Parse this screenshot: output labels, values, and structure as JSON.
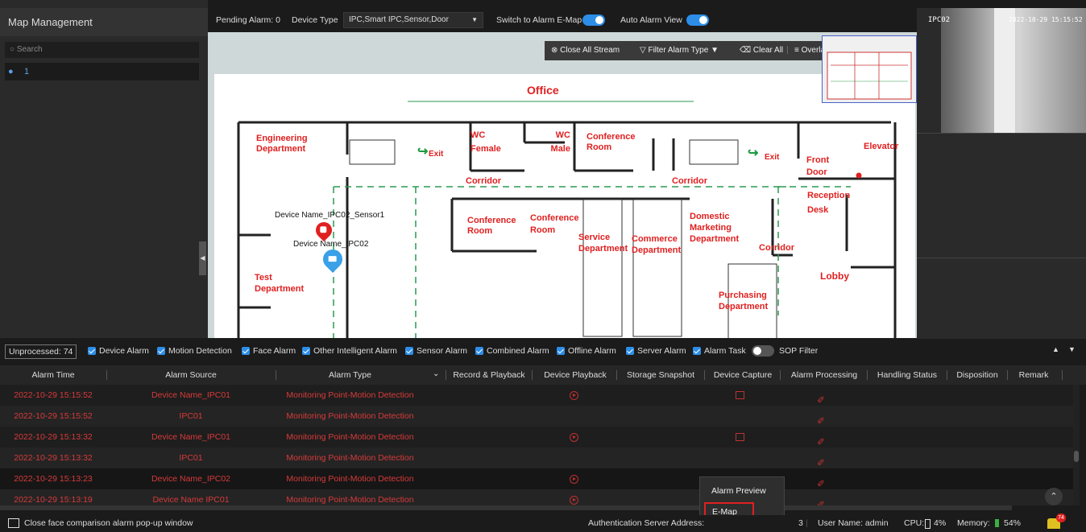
{
  "left_panel": {
    "title": "Map Management",
    "search_placeholder": "Search",
    "tree_node": "1"
  },
  "toolbar": {
    "pending_alarm": "Pending Alarm: 0",
    "device_type_label": "Device Type",
    "device_type_value": "IPC,Smart IPC,Sensor,Door",
    "switch_emap_label": "Switch to Alarm E-Map",
    "switch_emap_on": true,
    "auto_alarm_label": "Auto Alarm View",
    "auto_alarm_on": true
  },
  "map_tools": {
    "close_all_stream": "Close All Stream",
    "filter_alarm_type": "Filter Alarm Type",
    "clear_all": "Clear All",
    "overlap": "Overlap"
  },
  "floorplan": {
    "title": "Office",
    "rooms": [
      "Engineering Department",
      "Exit",
      "WC Female",
      "WC Male",
      "Conference Room",
      "Exit",
      "Front Door",
      "Elevator",
      "Corridor",
      "Corridor",
      "Reception Desk",
      "Conference Room",
      "Conference Room",
      "Service Department",
      "Commerce Department",
      "Domestic Marketing Department",
      "Corridor",
      "Lobby",
      "Test Department",
      "Purchasing Department"
    ],
    "marker_sensor": "Device Name_IPC02_Sensor1",
    "marker_ipc": "Device Name_IPC02"
  },
  "video": {
    "channel_label": "IPC02",
    "timestamp": "2022-10-29 15:15:52"
  },
  "filters": {
    "unprocessed": "Unprocessed: 74",
    "items": [
      "Device Alarm",
      "Motion Detection",
      "Face Alarm",
      "Other Intelligent Alarm",
      "Sensor Alarm",
      "Combined Alarm",
      "Offline Alarm",
      "Server Alarm",
      "Alarm Task"
    ],
    "sop_filter": "SOP Filter"
  },
  "table": {
    "headers": [
      "Alarm Time",
      "Alarm Source",
      "Alarm Type",
      "Record & Playback",
      "Device Playback",
      "Storage Snapshot",
      "Device Capture",
      "Alarm Processing",
      "Handling Status",
      "Disposition",
      "Remark"
    ],
    "rows": [
      {
        "time": "2022-10-29 15:15:52",
        "source": "Device Name_IPC01",
        "type": "Monitoring Point-Motion Detection",
        "playback": true,
        "capture": true
      },
      {
        "time": "2022-10-29 15:15:52",
        "source": "IPC01",
        "type": "Monitoring Point-Motion Detection",
        "playback": false,
        "capture": false
      },
      {
        "time": "2022-10-29 15:13:32",
        "source": "Device Name_IPC01",
        "type": "Monitoring Point-Motion Detection",
        "playback": true,
        "capture": true
      },
      {
        "time": "2022-10-29 15:13:32",
        "source": "IPC01",
        "type": "Monitoring Point-Motion Detection",
        "playback": false,
        "capture": false
      },
      {
        "time": "2022-10-29 15:13:23",
        "source": "Device Name_IPC02",
        "type": "Monitoring Point-Motion Detection",
        "playback": true,
        "capture": false
      },
      {
        "time": "2022-10-29 15:13:19",
        "source": "Device Name IPC01",
        "type": "Monitoring Point-Motion Detection",
        "playback": true,
        "capture": false
      }
    ]
  },
  "context_menu": {
    "items": [
      "Alarm Preview",
      "E-Map"
    ],
    "highlighted": "E-Map"
  },
  "status": {
    "close_face": "Close face comparison alarm pop-up window",
    "auth_server": "Authentication Server Address:",
    "port_suffix": "3",
    "user": "User Name: admin",
    "cpu": "CPU:",
    "cpu_value": "4%",
    "memory": "Memory:",
    "memory_value": "54%",
    "alarm_count": "74"
  },
  "colors": {
    "accent": "#2d8ee8",
    "alarm_red": "#d83a3a",
    "map_red": "#e02020",
    "corridor_green": "#22aa55",
    "highlight_box": "#e02020"
  }
}
